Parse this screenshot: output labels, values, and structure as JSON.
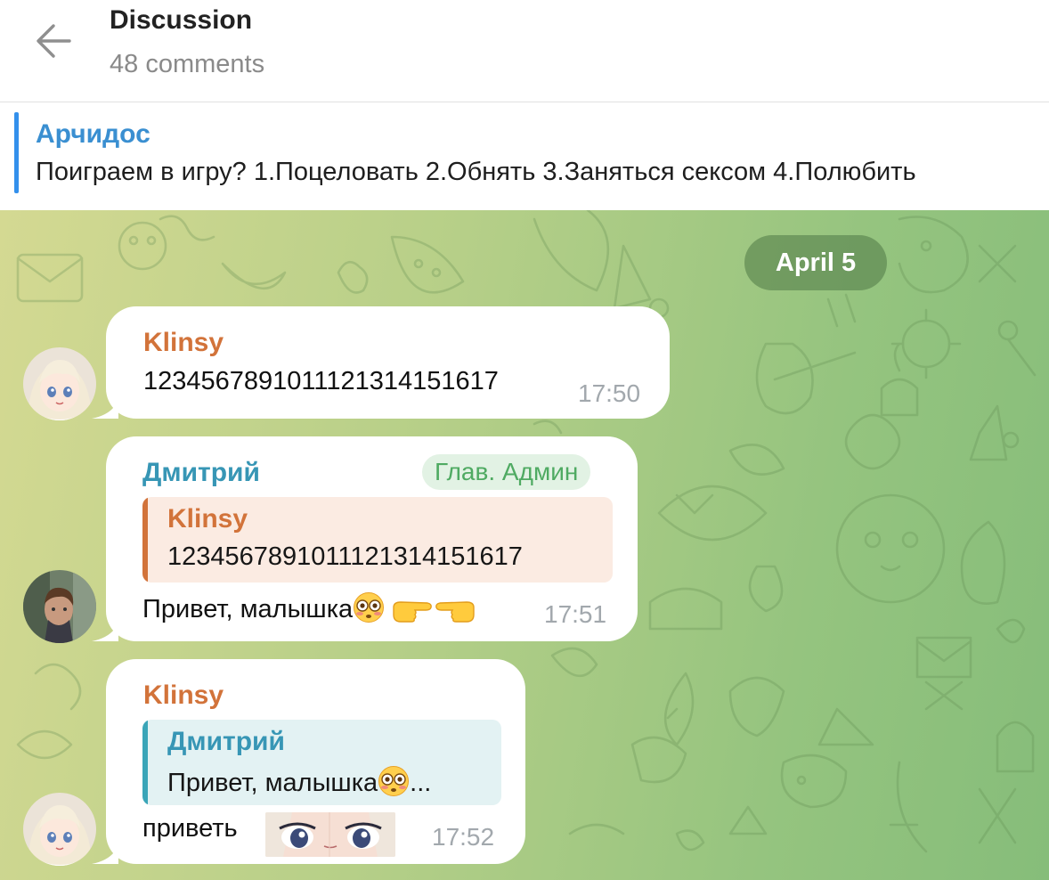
{
  "header": {
    "title": "Discussion",
    "subtitle": "48 comments"
  },
  "post": {
    "author": "Арчидос",
    "text": "Поиграем в игру? 1.Поцеловать 2.Обнять 3.Заняться сексом 4.Полюбить"
  },
  "chat": {
    "date_label": "April 5",
    "messages": [
      {
        "sender": "Klinsy",
        "sender_color": "#d2733a",
        "text": "1234567891011121314151617",
        "time": "17:50"
      },
      {
        "sender": "Дмитрий",
        "sender_color": "#3796b5",
        "badge": "Глав. Админ",
        "reply": {
          "name": "Klinsy",
          "text": "1234567891011121314151617",
          "bar_color": "#d2733a",
          "bg_color": "#fbebe2"
        },
        "text": "Привет, малышка",
        "emojis": [
          "flushed-face-emoji",
          "pointing-right-emoji",
          "pointing-left-emoji"
        ],
        "time": "17:51"
      },
      {
        "sender": "Klinsy",
        "sender_color": "#d2733a",
        "reply": {
          "name": "Дмитрий",
          "text": "Привет, малышка",
          "text_suffix": "...",
          "bar_color": "#3aa5b8",
          "bg_color": "#e3f2f3"
        },
        "text": "приветь",
        "sticker": "anime-eyes-sticker",
        "time": "17:52"
      }
    ]
  },
  "colors": {
    "accent": "#3390ec",
    "bubble": "#ffffff",
    "badge_text": "#4faa62"
  }
}
